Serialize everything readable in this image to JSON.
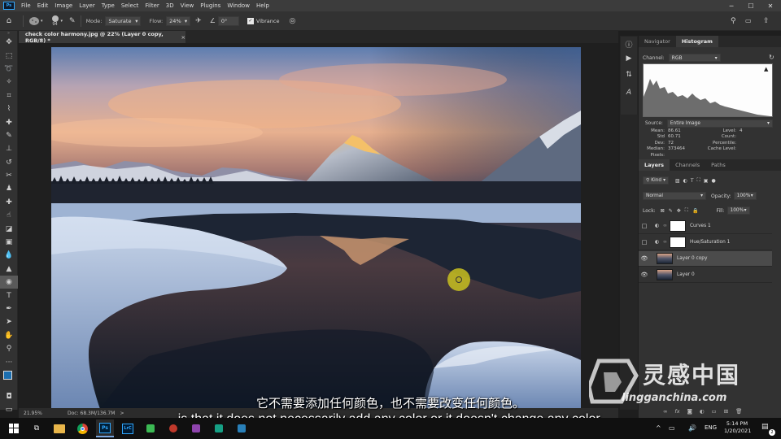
{
  "menubar": {
    "app_logo": "Ps",
    "items": [
      "File",
      "Edit",
      "Image",
      "Layer",
      "Type",
      "Select",
      "Filter",
      "3D",
      "View",
      "Plugins",
      "Window",
      "Help"
    ],
    "window_controls": [
      "minimize-icon",
      "maximize-icon",
      "close-icon"
    ]
  },
  "options": {
    "brush_size": "94",
    "mode_label": "Mode:",
    "mode_value": "Saturate",
    "flow_label": "Flow:",
    "flow_value": "24%",
    "angle_value": "0°",
    "vibrance_label": "Vibrance",
    "vibrance_checked": true
  },
  "document": {
    "tab_title": "check color harmony.jpg @ 22% (Layer 0 copy, RGB/8) *",
    "close": "×"
  },
  "status": {
    "zoom": "21.95%",
    "doc_size": "Doc: 68.3M/136.7M",
    "arrow": ">"
  },
  "histogram_panel": {
    "tabs": [
      "Navigator",
      "Histogram"
    ],
    "active_tab": "Histogram",
    "channel_label": "Channel:",
    "channel_value": "RGB",
    "source_label": "Source:",
    "source_value": "Entire Image",
    "stats_left": [
      {
        "label": "Mean:",
        "value": "86.61"
      },
      {
        "label": "Std Dev:",
        "value": "60.71"
      },
      {
        "label": "Median:",
        "value": "72"
      },
      {
        "label": "Pixels:",
        "value": "373464"
      }
    ],
    "stats_right": [
      {
        "label": "Level:",
        "value": ""
      },
      {
        "label": "Count:",
        "value": ""
      },
      {
        "label": "Percentile:",
        "value": ""
      },
      {
        "label": "Cache Level:",
        "value": "4"
      }
    ]
  },
  "layers_panel": {
    "tabs": [
      "Layers",
      "Channels",
      "Paths"
    ],
    "active_tab": "Layers",
    "filter_value": "Kind",
    "blend_mode": "Normal",
    "opacity_label": "Opacity:",
    "opacity_value": "100%",
    "lock_label": "Lock:",
    "fill_label": "Fill:",
    "fill_value": "100%",
    "layers": [
      {
        "name": "Curves 1",
        "type": "adjustment",
        "visible": false,
        "selected": false
      },
      {
        "name": "Hue/Saturation 1",
        "type": "adjustment",
        "visible": false,
        "selected": false
      },
      {
        "name": "Layer 0 copy",
        "type": "image",
        "visible": true,
        "selected": true
      },
      {
        "name": "Layer 0",
        "type": "image",
        "visible": true,
        "selected": false
      }
    ]
  },
  "subtitles": {
    "zh": "它不需要添加任何颜色，也不需要改变任何颜色。",
    "en": "is that it does not necessarily add any color or it doesn't change any color."
  },
  "watermark": {
    "title": "灵感中国",
    "url": "lingganchina.com"
  },
  "taskbar": {
    "lang": "ENG",
    "time": "5:14 PM",
    "date": "1/20/2021",
    "notification_count": "2",
    "apps": [
      "windows-start-icon",
      "task-view-icon",
      "file-explorer-icon",
      "chrome-icon",
      "photoshop-icon",
      "lightroom-classic-icon",
      "app-icon",
      "app-icon",
      "app-icon",
      "app-icon",
      "app-icon"
    ]
  },
  "colors": {
    "accent": "#31a8ff",
    "panel_bg": "#323232",
    "selected_layer": "#4b4b4b",
    "cursor": "#c8c020"
  }
}
